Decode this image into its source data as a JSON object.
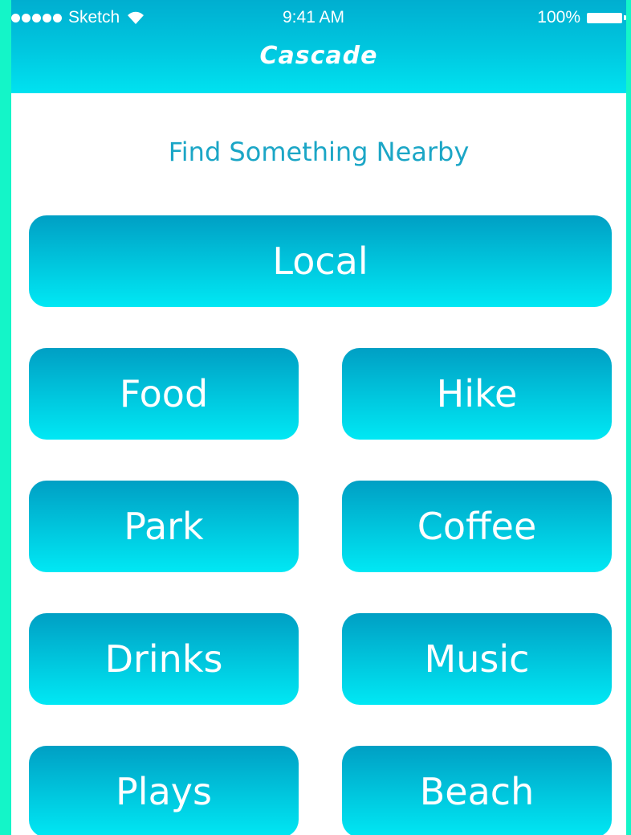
{
  "status_bar": {
    "carrier": "Sketch",
    "time": "9:41 AM",
    "battery": "100%"
  },
  "header": {
    "title": "Cascade"
  },
  "main": {
    "subtitle": "Find Something Nearby",
    "primary_button": "Local",
    "categories": [
      {
        "label": "Food"
      },
      {
        "label": "Hike"
      },
      {
        "label": "Park"
      },
      {
        "label": "Coffee"
      },
      {
        "label": "Drinks"
      },
      {
        "label": "Music"
      },
      {
        "label": "Plays"
      },
      {
        "label": "Beach"
      }
    ]
  },
  "colors": {
    "page_border": "#14f5c8",
    "header_top": "#00aed0",
    "header_bottom": "#00e2f0",
    "button_top": "#009fc4",
    "button_bottom": "#00e8f4",
    "subtitle_text": "#1ba6c6"
  }
}
